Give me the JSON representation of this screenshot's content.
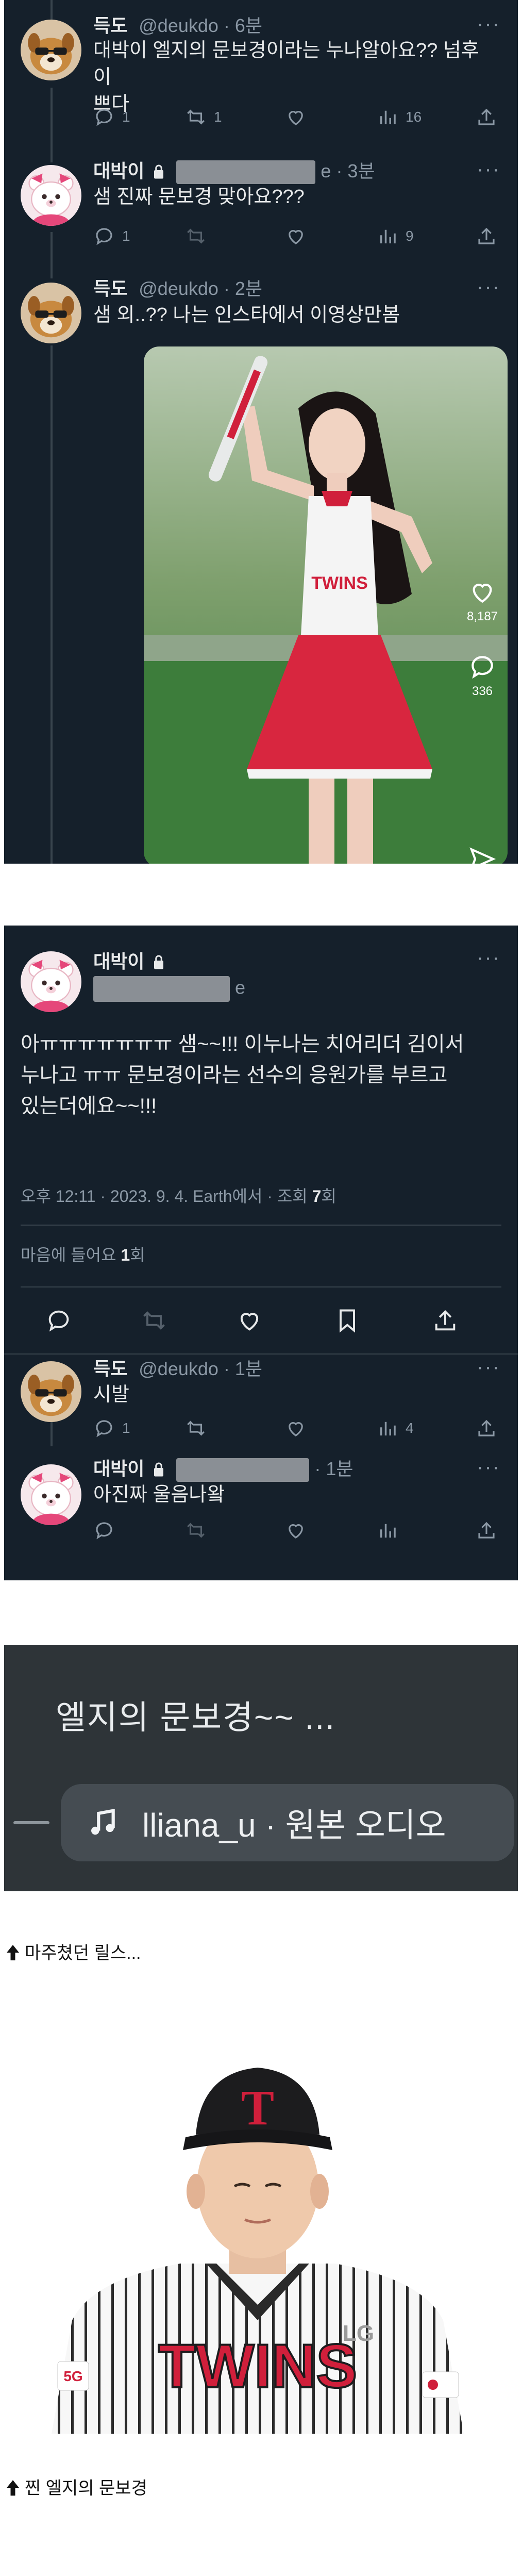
{
  "tweets": [
    {
      "name": "득도",
      "handle": "@deukdo · 6분",
      "text_lines": [
        "대박이 엘지의 문보경이라는 누나알아요?? 넘후이",
        "쁘다"
      ],
      "stats": {
        "reply": "1",
        "retweet": "1",
        "like": "",
        "views": "16"
      }
    },
    {
      "name": "대박이",
      "handle_suffix": "e · 3분",
      "text_lines": [
        "샘 진짜 문보경 맞아요???"
      ],
      "stats": {
        "reply": "1",
        "retweet": "",
        "like": "",
        "views": "9"
      }
    },
    {
      "name": "득도",
      "handle": "@deukdo · 2분",
      "text_lines": [
        "샘 외..?? 나는 인스타에서 이영상만봄"
      ],
      "video_stats": {
        "likes": "8,187",
        "comments": "336"
      }
    }
  ],
  "detail": {
    "name": "대박이",
    "handle_suffix": "e",
    "text_lines": [
      "아ㅠㅠㅠㅠㅠㅠㅠ 샘~~!!! 이누나는 치어리더 김이서",
      "누나고 ㅠㅠ 문보경이라는 선수의 응원가를 부르고",
      "있는더에요~~!!!"
    ],
    "meta_prefix": "오후 12:11 · 2023. 9. 4. Earth에서 · 조회 ",
    "meta_views": "7",
    "meta_suffix": "회",
    "likes_prefix": "마음에 들어요 ",
    "likes_count": "1",
    "likes_suffix": "회"
  },
  "replies": [
    {
      "name": "득도",
      "handle": "@deukdo · 1분",
      "text_lines": [
        "시발"
      ],
      "stats": {
        "reply": "1",
        "retweet": "",
        "like": "",
        "views": "4"
      }
    },
    {
      "name": "대박이",
      "handle_suffix": "· 1분",
      "text_lines": [
        "아진짜 울음나왘"
      ],
      "stats": {
        "reply": "",
        "retweet": "",
        "like": "",
        "views": ""
      }
    }
  ],
  "reel": {
    "caption": "엘지의 문보경~~ ...",
    "audio": "lliana_u · 원본 오디오"
  },
  "jersey": {
    "cap_letter": "T",
    "team": "TWINS",
    "patch": "LG",
    "sleeve": "5G"
  },
  "captions": [
    "마주쳤던 릴스...",
    "찐 엘지의 문보경"
  ],
  "colors": {
    "bg": "#15202b",
    "text": "#e7e9ea",
    "muted": "#8b98a5",
    "divider": "#38444d",
    "twins_red": "#d01f3b"
  }
}
